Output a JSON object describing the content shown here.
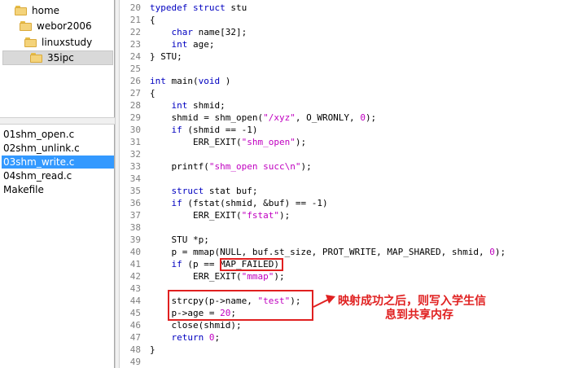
{
  "folder_tree": [
    {
      "name": "home",
      "depth": 0,
      "selected": false
    },
    {
      "name": "webor2006",
      "depth": 1,
      "selected": false
    },
    {
      "name": "linuxstudy",
      "depth": 2,
      "selected": false
    },
    {
      "name": "35ipc",
      "depth": 3,
      "selected": true
    }
  ],
  "files": [
    {
      "name": "01shm_open.c",
      "selected": false
    },
    {
      "name": "02shm_unlink.c",
      "selected": false
    },
    {
      "name": "03shm_write.c",
      "selected": true
    },
    {
      "name": "04shm_read.c",
      "selected": false
    },
    {
      "name": "Makefile",
      "selected": false
    }
  ],
  "code_lines": [
    {
      "n": "20",
      "tokens": [
        [
          "kw",
          "typedef struct"
        ],
        [
          "",
          "stu"
        ]
      ]
    },
    {
      "n": "21",
      "tokens": [
        [
          "",
          "{"
        ]
      ]
    },
    {
      "n": "22",
      "tokens": [
        [
          "",
          "    "
        ],
        [
          "kw",
          "char"
        ],
        [
          "",
          "name[32];"
        ]
      ]
    },
    {
      "n": "23",
      "tokens": [
        [
          "",
          "    "
        ],
        [
          "kw",
          "int"
        ],
        [
          "",
          "age;"
        ]
      ]
    },
    {
      "n": "24",
      "tokens": [
        [
          "",
          "} STU;"
        ]
      ]
    },
    {
      "n": "25",
      "tokens": []
    },
    {
      "n": "26",
      "tokens": [
        [
          "kw",
          "int"
        ],
        [
          "",
          "main("
        ],
        [
          "kw",
          "void"
        ],
        [
          "",
          ")"
        ]
      ]
    },
    {
      "n": "27",
      "tokens": [
        [
          "",
          "{"
        ]
      ]
    },
    {
      "n": "28",
      "tokens": [
        [
          "",
          "    "
        ],
        [
          "kw",
          "int"
        ],
        [
          "",
          "shmid;"
        ]
      ]
    },
    {
      "n": "29",
      "tokens": [
        [
          "",
          "    shmid = shm_open("
        ],
        [
          "str",
          "\"/xyz\""
        ],
        [
          "",
          ", O_WRONLY, "
        ],
        [
          "str",
          "0"
        ],
        [
          "",
          ");"
        ]
      ]
    },
    {
      "n": "30",
      "tokens": [
        [
          "",
          "    "
        ],
        [
          "kw",
          "if"
        ],
        [
          "",
          "(shmid == -1)"
        ]
      ]
    },
    {
      "n": "31",
      "tokens": [
        [
          "",
          "        ERR_EXIT("
        ],
        [
          "str",
          "\"shm_open\""
        ],
        [
          "",
          ");"
        ]
      ]
    },
    {
      "n": "32",
      "tokens": []
    },
    {
      "n": "33",
      "tokens": [
        [
          "",
          "    printf("
        ],
        [
          "str",
          "\"shm_open succ\\n\""
        ],
        [
          "",
          ");"
        ]
      ]
    },
    {
      "n": "34",
      "tokens": []
    },
    {
      "n": "35",
      "tokens": [
        [
          "",
          "    "
        ],
        [
          "kw",
          "struct"
        ],
        [
          "",
          "stat buf;"
        ]
      ]
    },
    {
      "n": "36",
      "tokens": [
        [
          "",
          "    "
        ],
        [
          "kw",
          "if"
        ],
        [
          "",
          "(fstat(shmid, &buf) == -1)"
        ]
      ]
    },
    {
      "n": "37",
      "tokens": [
        [
          "",
          "        ERR_EXIT("
        ],
        [
          "str",
          "\"fstat\""
        ],
        [
          "",
          ");"
        ]
      ]
    },
    {
      "n": "38",
      "tokens": []
    },
    {
      "n": "39",
      "tokens": [
        [
          "",
          "    STU *p;"
        ]
      ]
    },
    {
      "n": "40",
      "tokens": [
        [
          "",
          "    p = mmap(NULL, buf.st_size, PROT_WRITE, MAP_SHARED, shmid, "
        ],
        [
          "str",
          "0"
        ],
        [
          "",
          ");"
        ]
      ]
    },
    {
      "n": "41",
      "tokens": [
        [
          "",
          "    "
        ],
        [
          "kw",
          "if"
        ],
        [
          "",
          "(p == MAP_FAILED)"
        ]
      ]
    },
    {
      "n": "42",
      "tokens": [
        [
          "",
          "        ERR_EXIT("
        ],
        [
          "str",
          "\"mmap\""
        ],
        [
          "",
          ");"
        ]
      ]
    },
    {
      "n": "43",
      "tokens": []
    },
    {
      "n": "44",
      "tokens": [
        [
          "",
          "    strcpy(p->name, "
        ],
        [
          "str",
          "\"test\""
        ],
        [
          "",
          ");"
        ]
      ]
    },
    {
      "n": "45",
      "tokens": [
        [
          "",
          "    p->age = "
        ],
        [
          "str",
          "20"
        ],
        [
          "",
          ";"
        ]
      ]
    },
    {
      "n": "46",
      "tokens": [
        [
          "",
          "    close(shmid);"
        ]
      ]
    },
    {
      "n": "47",
      "tokens": [
        [
          "",
          "    "
        ],
        [
          "kw",
          "return"
        ],
        [
          "str",
          "0"
        ],
        [
          "",
          ";"
        ]
      ]
    },
    {
      "n": "48",
      "tokens": [
        [
          "",
          "}"
        ]
      ]
    },
    {
      "n": "49",
      "tokens": []
    }
  ],
  "annotation": {
    "line1": "映射成功之后，则写入学生信",
    "line2": "息到共享内存"
  },
  "colors": {
    "keyword": "#0000c0",
    "string": "#c000c0",
    "line_number": "#808080",
    "annotation": "#e02020",
    "selection": "#3399ff"
  }
}
